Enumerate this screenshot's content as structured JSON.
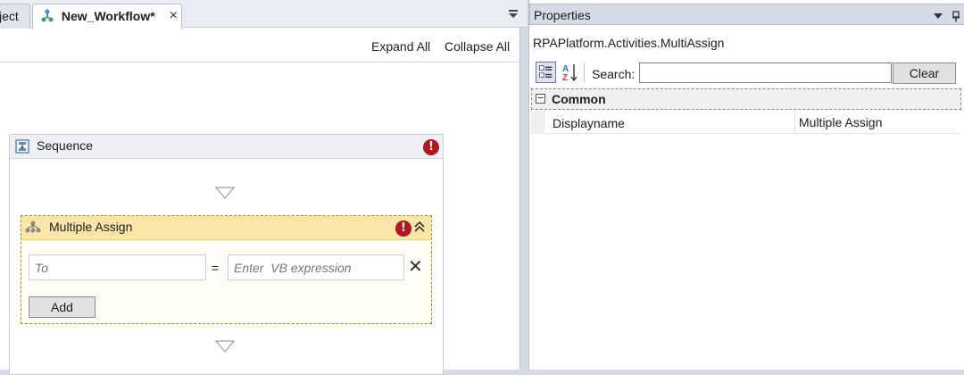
{
  "tabs": [
    {
      "label": "ject"
    },
    {
      "label": "New_Workflow*",
      "close": "×"
    }
  ],
  "canvas": {
    "expand_all": "Expand All",
    "collapse_all": "Collapse All"
  },
  "sequence": {
    "title": "Sequence",
    "error_glyph": "!"
  },
  "multiple_assign": {
    "title": "Multiple Assign",
    "error_glyph": "!",
    "to_placeholder": "To",
    "equals": "=",
    "expr_placeholder": "Enter  VB expression",
    "remove_glyph": "✕",
    "add_label": "Add"
  },
  "properties": {
    "title": "Properties",
    "class_name": "RPAPlatform.Activities.MultiAssign",
    "search_label": "Search:",
    "search_value": "",
    "clear_label": "Clear",
    "category": {
      "toggle": "−",
      "label": "Common"
    },
    "rows": [
      {
        "name": "Displayname",
        "value": "Multiple Assign"
      }
    ]
  },
  "colors": {
    "accent": "#fbe6a8",
    "error": "#b1151d",
    "panel": "#d6dbe9"
  }
}
